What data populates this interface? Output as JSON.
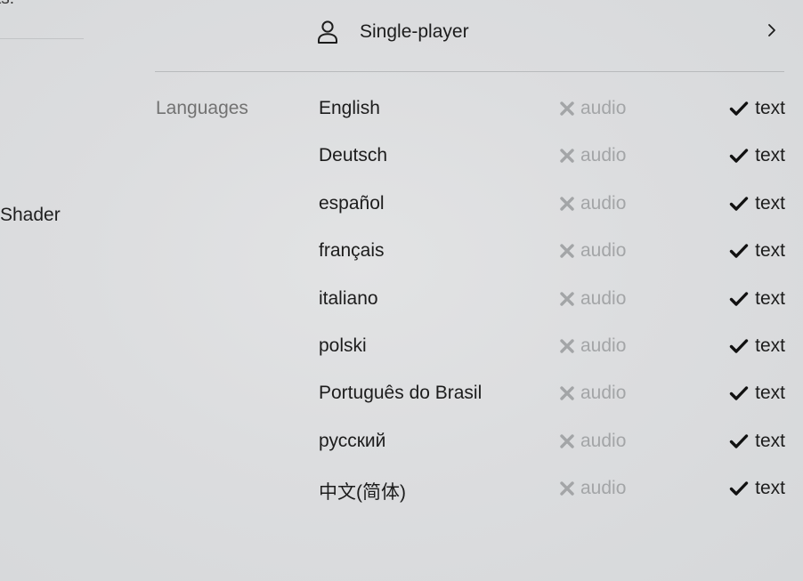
{
  "left_panel": {
    "top_text": "ts:",
    "shader_text": "Shader"
  },
  "game_mode": {
    "icon": "user-icon",
    "label": "Single-player",
    "chevron_icon": "chevron-right-icon"
  },
  "languages": {
    "heading": "Languages",
    "audio_icon": "x-icon",
    "text_icon": "check-icon",
    "audio_color": "#a3a5a7",
    "text_color": "#1c1c1c",
    "rows": [
      {
        "name": "English",
        "audio_label": "audio",
        "audio_supported": false,
        "text_label": "text",
        "text_supported": true
      },
      {
        "name": "Deutsch",
        "audio_label": "audio",
        "audio_supported": false,
        "text_label": "text",
        "text_supported": true
      },
      {
        "name": "español",
        "audio_label": "audio",
        "audio_supported": false,
        "text_label": "text",
        "text_supported": true
      },
      {
        "name": "français",
        "audio_label": "audio",
        "audio_supported": false,
        "text_label": "text",
        "text_supported": true
      },
      {
        "name": "italiano",
        "audio_label": "audio",
        "audio_supported": false,
        "text_label": "text",
        "text_supported": true
      },
      {
        "name": "polski",
        "audio_label": "audio",
        "audio_supported": false,
        "text_label": "text",
        "text_supported": true
      },
      {
        "name": "Português do Brasil",
        "audio_label": "audio",
        "audio_supported": false,
        "text_label": "text",
        "text_supported": true
      },
      {
        "name": "русский",
        "audio_label": "audio",
        "audio_supported": false,
        "text_label": "text",
        "text_supported": true
      },
      {
        "name": "中文(简体)",
        "audio_label": "audio",
        "audio_supported": false,
        "text_label": "text",
        "text_supported": true
      }
    ]
  }
}
